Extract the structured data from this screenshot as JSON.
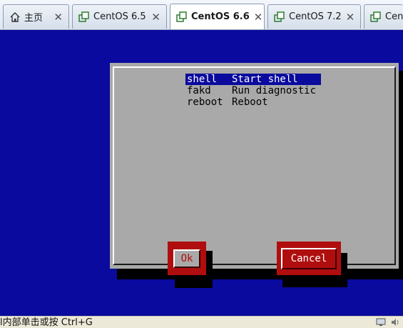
{
  "tabs": [
    {
      "label": "主页",
      "icon": "home-icon"
    },
    {
      "label": "CentOS 6.5",
      "icon": "vm-icon"
    },
    {
      "label": "CentOS 6.6",
      "icon": "vm-icon",
      "active": true
    },
    {
      "label": "CentOS 7.2",
      "icon": "vm-icon"
    },
    {
      "label": "Cent",
      "icon": "vm-icon"
    }
  ],
  "dialog": {
    "menu": [
      {
        "cmd": "shell",
        "desc": "Start shell",
        "selected": true
      },
      {
        "cmd": "fakd",
        "desc": "Run diagnostic"
      },
      {
        "cmd": "reboot",
        "desc": "Reboot"
      }
    ],
    "ok_label": "Ok",
    "cancel_label": "Cancel"
  },
  "status_bar": {
    "text": "l内部单击或按 Ctrl+G"
  },
  "colors": {
    "console_bg": "#0a0a9e",
    "dialog_bg": "#a9a9a9",
    "button_red": "#b00e0e"
  }
}
